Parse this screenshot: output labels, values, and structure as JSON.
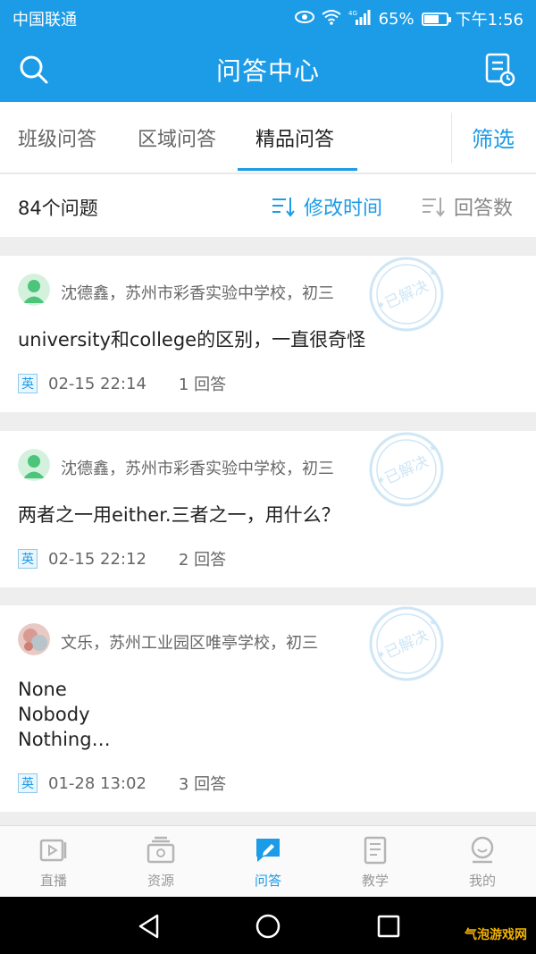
{
  "status_bar": {
    "carrier": "中国联通",
    "network": "4G",
    "battery": "65%",
    "battery_level": 0.65,
    "time": "下午1:56"
  },
  "header": {
    "title": "问答中心"
  },
  "tabs": [
    {
      "label": "班级问答",
      "active": false
    },
    {
      "label": "区域问答",
      "active": false
    },
    {
      "label": "精品问答",
      "active": true
    }
  ],
  "filter_label": "筛选",
  "list": {
    "count_label": "84个问题",
    "sort_options": [
      {
        "label": "修改时间",
        "active": true
      },
      {
        "label": "回答数",
        "active": false
      }
    ]
  },
  "stamp_text": "已解决",
  "posts": [
    {
      "user": "沈德鑫，苏州市彩香实验中学校，初三",
      "question": "university和college的区别，一直很奇怪",
      "subject": "英",
      "date": "02-15 22:14",
      "answers": "1 回答"
    },
    {
      "user": "沈德鑫，苏州市彩香实验中学校，初三",
      "question": "两者之一用either.三者之一，用什么？",
      "subject": "英",
      "date": "02-15 22:12",
      "answers": "2 回答"
    },
    {
      "user": "文乐，苏州工业园区唯亭学校，初三",
      "question_lines": [
        "None",
        "Nobody",
        "Nothing…"
      ],
      "subject": "英",
      "date": "01-28 13:02",
      "answers": "3 回答"
    }
  ],
  "bottom_nav": [
    {
      "label": "直播",
      "icon": "live-icon",
      "active": false
    },
    {
      "label": "资源",
      "icon": "resource-icon",
      "active": false
    },
    {
      "label": "问答",
      "icon": "qa-icon",
      "active": true
    },
    {
      "label": "教学",
      "icon": "teaching-icon",
      "active": false
    },
    {
      "label": "我的",
      "icon": "profile-icon",
      "active": false
    }
  ],
  "watermark": "气泡游戏网",
  "colors": {
    "accent": "#1c9be6",
    "inactive": "#999999",
    "background": "#eeeeee"
  }
}
